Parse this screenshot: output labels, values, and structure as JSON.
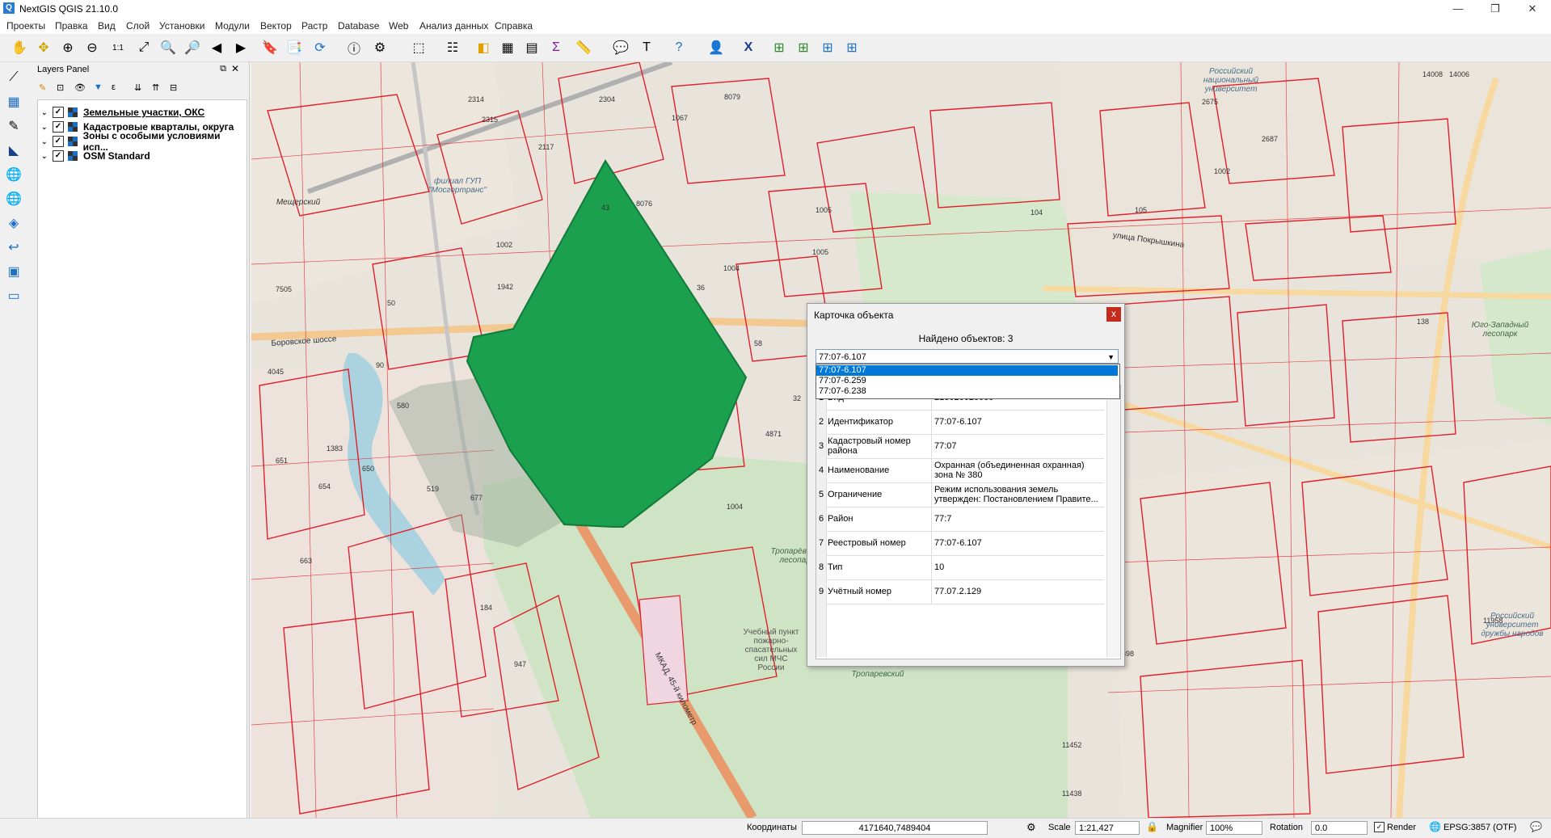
{
  "window": {
    "title": "NextGIS QGIS 21.10.0",
    "minimize": "—",
    "restore": "❐",
    "close": "✕"
  },
  "menu": [
    "Проекты",
    "Правка",
    "Вид",
    "Слой",
    "Установки",
    "Модули",
    "Вектор",
    "Растр",
    "Database",
    "Web",
    "Анализ данных",
    "Справка"
  ],
  "layers_panel": {
    "title": "Layers Panel",
    "layers": [
      {
        "name": "Земельные участки, ОКС",
        "checked": true,
        "underlined": true
      },
      {
        "name": "Кадастровые кварталы, округа",
        "checked": true
      },
      {
        "name": "Зоны с особыми условиями исп...",
        "checked": true
      },
      {
        "name": "OSM Standard",
        "checked": true
      }
    ]
  },
  "map": {
    "place_labels": [
      "Российский университет дружбы народов",
      "Юго-Западный лесопарк",
      "Тропарёвский лесопарк",
      "Учебный пункт пожарно-спасательных сил МЧС России",
      "улица Покрышкина",
      "Боровское шоссе",
      "МКАД, 45-й километр",
      "Тропаревский",
      "филиал ГУП \"Мосгортранс\"",
      "Российский национальный университет",
      "Мещерский"
    ],
    "numbers": [
      "2304",
      "8079",
      "1067",
      "1002",
      "8076",
      "1005",
      "1004",
      "580",
      "519",
      "947",
      "184",
      "4871",
      "14008",
      "2687",
      "2675",
      "1002",
      "138",
      "9898",
      "11958",
      "11452",
      "11438",
      "4045",
      "654",
      "663",
      "651",
      "90",
      "36",
      "58",
      "32",
      "43",
      "1383",
      "677",
      "650",
      "1942",
      "7505",
      "50",
      "14006",
      "1004",
      "1005",
      "104",
      "105",
      "2314",
      "2315",
      "2117"
    ]
  },
  "dialog": {
    "title": "Карточка объекта",
    "close": "x",
    "found": "Найдено объектов: 3",
    "selected": "77:07-6.107",
    "options": [
      "77:07-6.107",
      "77:07-6.259",
      "77:07-6.238"
    ],
    "rows": [
      {
        "n": "1",
        "key": "Вид",
        "value": "218020020000"
      },
      {
        "n": "2",
        "key": "Идентификатор",
        "value": "77:07-6.107"
      },
      {
        "n": "3",
        "key": "Кадастровый номер района",
        "value": "77:07"
      },
      {
        "n": "4",
        "key": "Наименование",
        "value": "Охранная (объединенная охранная) зона № 380"
      },
      {
        "n": "5",
        "key": "Ограничение",
        "value": "Режим использования земель утвержден: Постановлением Правите..."
      },
      {
        "n": "6",
        "key": "Район",
        "value": "77:7"
      },
      {
        "n": "7",
        "key": "Реестровый номер",
        "value": "77:07-6.107"
      },
      {
        "n": "8",
        "key": "Тип",
        "value": "10"
      },
      {
        "n": "9",
        "key": "Учётный номер",
        "value": "77.07.2.129"
      }
    ]
  },
  "status": {
    "coord_label": "Координаты",
    "coord_value": "4171640,7489404",
    "scale_label": "Scale",
    "scale_value": "1:21,427",
    "magnifier_label": "Magnifier",
    "magnifier_value": "100%",
    "rotation_label": "Rotation",
    "rotation_value": "0.0",
    "render_label": "Render",
    "crs": "EPSG:3857 (OTF)"
  },
  "colors": {
    "polygon_fill": "#1aa04f",
    "parcel_stroke": "#e0202a",
    "forest": "#cde2c4",
    "accent": "#0078d7"
  }
}
